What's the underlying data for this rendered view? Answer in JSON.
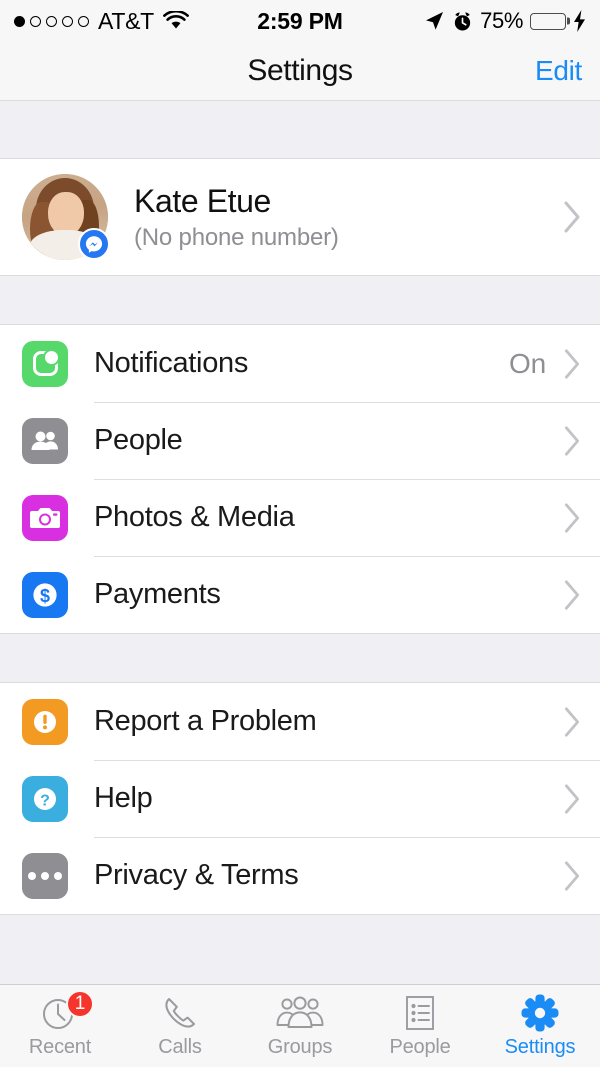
{
  "status_bar": {
    "carrier": "AT&T",
    "signal_bars_filled": 1,
    "signal_bars_total": 5,
    "wifi_icon": "wifi-icon",
    "time": "2:59 PM",
    "location_icon": "location-arrow-icon",
    "alarm_icon": "alarm-clock-icon",
    "battery_percent": "75%",
    "battery_level": 75,
    "charging_icon": "lightning-bolt-icon"
  },
  "nav_bar": {
    "title": "Settings",
    "edit_label": "Edit",
    "accent_color": "#1b8cf5"
  },
  "profile": {
    "name": "Kate Etue",
    "subtitle": "(No phone number)",
    "avatar_icon": "user-avatar-photo",
    "badge_icon": "messenger-badge-icon",
    "chevron_icon": "chevron-right-icon"
  },
  "groups": [
    {
      "rows": [
        {
          "label": "Notifications",
          "value": "On",
          "icon": "notifications-icon",
          "icon_color": "#56d96a",
          "chevron_icon": "chevron-right-icon"
        },
        {
          "label": "People",
          "value": "",
          "icon": "people-icon",
          "icon_color": "#8e8e93",
          "chevron_icon": "chevron-right-icon"
        },
        {
          "label": "Photos & Media",
          "value": "",
          "icon": "camera-icon",
          "icon_color": "#d830e0",
          "chevron_icon": "chevron-right-icon"
        },
        {
          "label": "Payments",
          "value": "",
          "icon": "payments-dollar-icon",
          "icon_color": "#1878f2",
          "chevron_icon": "chevron-right-icon"
        }
      ]
    },
    {
      "rows": [
        {
          "label": "Report a Problem",
          "value": "",
          "icon": "report-problem-icon",
          "icon_color": "#f29a21",
          "chevron_icon": "chevron-right-icon"
        },
        {
          "label": "Help",
          "value": "",
          "icon": "help-question-icon",
          "icon_color": "#3aaede",
          "chevron_icon": "chevron-right-icon"
        },
        {
          "label": "Privacy & Terms",
          "value": "",
          "icon": "privacy-terms-icon",
          "icon_color": "#8e8e93",
          "chevron_icon": "chevron-right-icon"
        }
      ]
    }
  ],
  "tab_bar": {
    "active_color": "#1b8cf5",
    "inactive_color": "#9a9a9f",
    "tabs": [
      {
        "label": "Recent",
        "icon": "clock-icon",
        "badge": "1",
        "active": false
      },
      {
        "label": "Calls",
        "icon": "phone-icon",
        "badge": "",
        "active": false
      },
      {
        "label": "Groups",
        "icon": "group-people-icon",
        "badge": "",
        "active": false
      },
      {
        "label": "People",
        "icon": "contacts-list-icon",
        "badge": "",
        "active": false
      },
      {
        "label": "Settings",
        "icon": "gear-icon",
        "badge": "",
        "active": true
      }
    ]
  }
}
